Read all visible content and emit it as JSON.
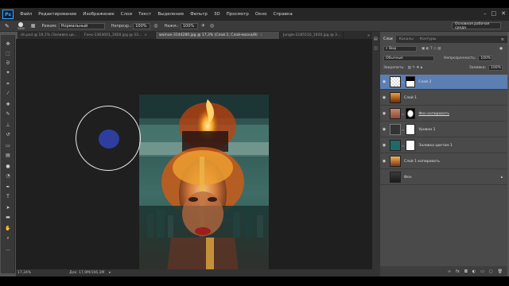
{
  "menu": {
    "logo": "Ps",
    "items": [
      "Файл",
      "Редактирование",
      "Изображение",
      "Слои",
      "Текст",
      "Выделение",
      "Фильтр",
      "3D",
      "Просмотр",
      "Окно",
      "Справка"
    ],
    "window_buttons": [
      "–",
      "□",
      "✕"
    ]
  },
  "options": {
    "brush_size": "1400",
    "mode_label": "Режим:",
    "mode_value": "Нормальный",
    "opacity_label": "Непрозр.:",
    "opacity_value": "100%",
    "flow_label": "Нажм.:",
    "flow_value": "100%",
    "workspace": "Основная рабочая среда"
  },
  "tabs": [
    {
      "label": "dn.psd @ 19,1% (Заливка цв...",
      "active": false
    },
    {
      "label": "Fоно-1363001_1920.jpg @ 33...",
      "active": false
    },
    {
      "label": "woman-3144280.jpg @ 17,3% (Слой 2, Слой-маска/8)",
      "active": true
    },
    {
      "label": "Jungle-2185510_1920.jpg @ 3...",
      "active": false
    }
  ],
  "status": {
    "zoom": "17,34%",
    "doc": "Док: 17,9М/166,3М"
  },
  "panel": {
    "tabs": [
      "Слои",
      "Каналы",
      "Контуры"
    ],
    "kind_label": "Вид",
    "blend_mode": "Обычные",
    "opacity_label": "Непрозрачность:",
    "opacity_value": "100%",
    "lock_label": "Закрепить:",
    "fill_label": "Заливка:",
    "fill_value": "100%",
    "layers": [
      {
        "name": "Слой 2",
        "selected": true,
        "visible": true
      },
      {
        "name": "Слой 1",
        "selected": false,
        "visible": true
      },
      {
        "name": "Фон копировать",
        "selected": false,
        "visible": true
      },
      {
        "name": "Уровни 1",
        "selected": false,
        "visible": true
      },
      {
        "name": "Заливка цветом 1",
        "selected": false,
        "visible": true
      },
      {
        "name": "Слой 1 копировать",
        "selected": false,
        "visible": true
      },
      {
        "name": "Фон",
        "selected": false,
        "visible": false
      }
    ],
    "bottom_icons": [
      "link-icon",
      "fx-icon",
      "mask-icon",
      "adjustment-icon",
      "folder-icon",
      "new-layer-icon",
      "trash-icon"
    ]
  },
  "colors": {
    "accent_selection": "#5b7fb2",
    "brush_color": "#2e3e9e"
  }
}
